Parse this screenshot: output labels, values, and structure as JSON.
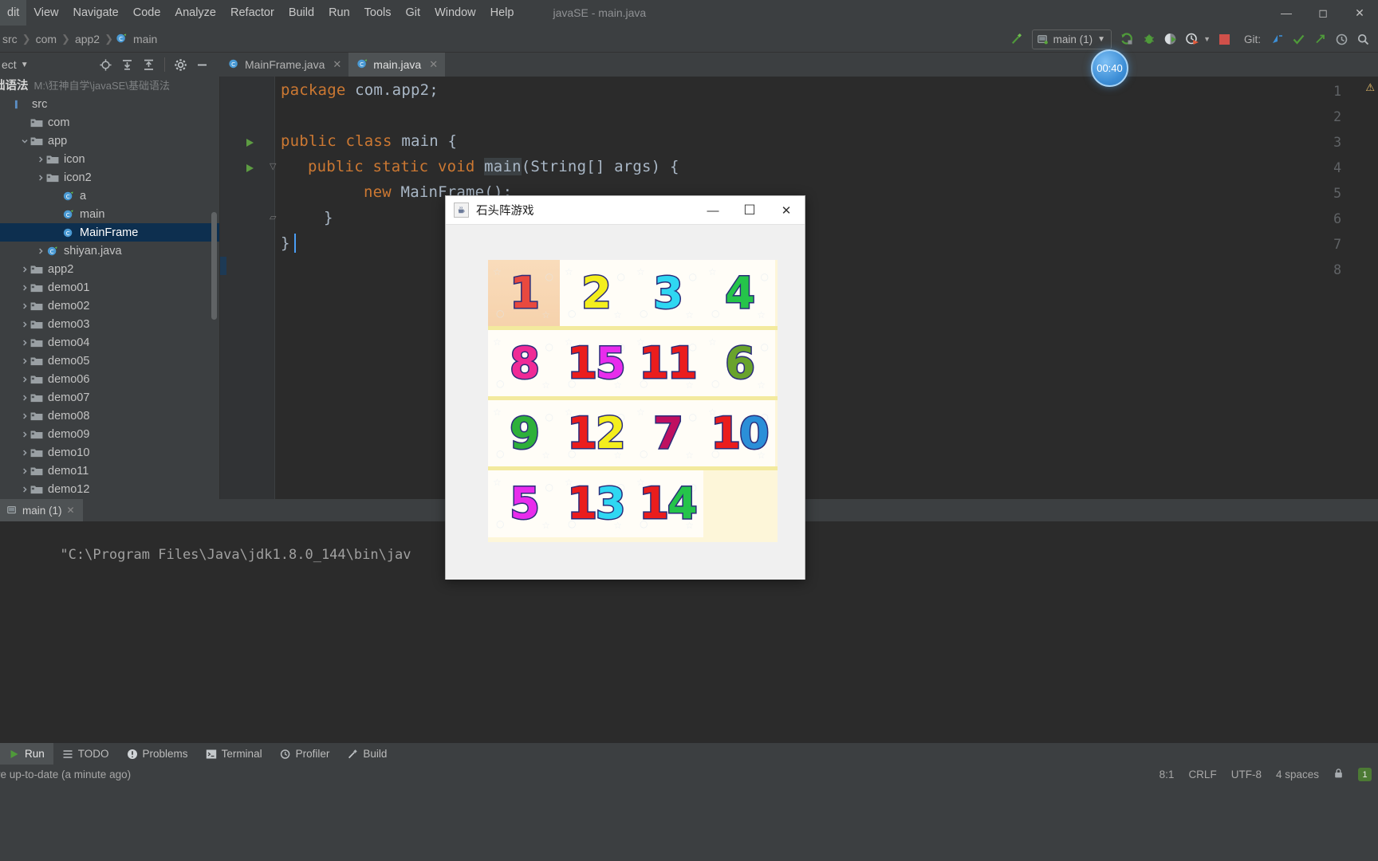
{
  "window": {
    "title": "javaSE - main.java",
    "minimize": "—",
    "maximize": "☐",
    "close": "✕"
  },
  "menubar": {
    "items": [
      {
        "label": "Edit",
        "visible": "dit"
      },
      {
        "label": "View"
      },
      {
        "label": "Navigate"
      },
      {
        "label": "Code"
      },
      {
        "label": "Analyze"
      },
      {
        "label": "Refactor"
      },
      {
        "label": "Build"
      },
      {
        "label": "Run"
      },
      {
        "label": "Tools"
      },
      {
        "label": "Git"
      },
      {
        "label": "Window"
      },
      {
        "label": "Help"
      }
    ]
  },
  "breadcrumb": {
    "items": [
      "src",
      "com",
      "app2",
      "main"
    ],
    "separator": "›",
    "last_icon": "java-class-icon"
  },
  "toolbar": {
    "build_icon": "hammer-icon",
    "run_config": "main (1)",
    "run_config_dropdown": "▾",
    "run_icon": "run-icon",
    "debug_icon": "debug-bug-icon",
    "run_coverage_icon": "run-with-coverage-icon",
    "profile_icon": "profiler-clock-icon",
    "profile_dropdown": "▾",
    "stop_icon": "stop-square-icon",
    "git_label": "Git:",
    "git_update_icon": "git-update-icon",
    "git_commit_icon": "git-commit-check-icon",
    "git_push_icon": "git-push-icon",
    "git_history_icon": "git-history-icon",
    "search_icon": "search-icon"
  },
  "toolstrip": {
    "project_label": "ect",
    "project_dropdown": "▾",
    "locate_icon": "locate-target-icon",
    "expand_icon": "expand-all-icon",
    "collapse_icon": "collapse-all-icon",
    "settings_icon": "gear-icon",
    "hide_icon": "hide-minus-icon"
  },
  "tabs": [
    {
      "label": "MainFrame.java",
      "icon": "java-class-icon",
      "active": false,
      "close": "✕"
    },
    {
      "label": "main.java",
      "icon": "java-class-icon",
      "active": true,
      "close": "✕"
    }
  ],
  "project_tree": {
    "root_name": "础语法",
    "root_path": "M:\\狂神自学\\javaSE\\基础语法",
    "nodes": [
      {
        "label": "src",
        "depth": 0,
        "icon": "source-root-icon",
        "arrow": "",
        "selected": false
      },
      {
        "label": "com",
        "depth": 1,
        "icon": "folder-icon",
        "arrow": "",
        "selected": false
      },
      {
        "label": "app",
        "depth": 1,
        "icon": "folder-icon",
        "arrow": "⌄",
        "selected": false
      },
      {
        "label": "icon",
        "depth": 2,
        "icon": "folder-icon",
        "arrow": "›",
        "selected": false
      },
      {
        "label": "icon2",
        "depth": 2,
        "icon": "folder-icon",
        "arrow": "›",
        "selected": false
      },
      {
        "label": "a",
        "depth": 3,
        "icon": "java-class-icon",
        "arrow": "",
        "selected": false
      },
      {
        "label": "main",
        "depth": 3,
        "icon": "java-class-icon",
        "arrow": "",
        "selected": false
      },
      {
        "label": "MainFrame",
        "depth": 3,
        "icon": "java-class-icon",
        "arrow": "",
        "selected": true
      },
      {
        "label": "shiyan.java",
        "depth": 2,
        "icon": "java-class-icon",
        "arrow": "›",
        "selected": false
      },
      {
        "label": "app2",
        "depth": 1,
        "icon": "folder-icon",
        "arrow": "›",
        "selected": false
      },
      {
        "label": "demo01",
        "depth": 1,
        "icon": "folder-icon",
        "arrow": "›",
        "selected": false
      },
      {
        "label": "demo02",
        "depth": 1,
        "icon": "folder-icon",
        "arrow": "›",
        "selected": false
      },
      {
        "label": "demo03",
        "depth": 1,
        "icon": "folder-icon",
        "arrow": "›",
        "selected": false
      },
      {
        "label": "demo04",
        "depth": 1,
        "icon": "folder-icon",
        "arrow": "›",
        "selected": false
      },
      {
        "label": "demo05",
        "depth": 1,
        "icon": "folder-icon",
        "arrow": "›",
        "selected": false
      },
      {
        "label": "demo06",
        "depth": 1,
        "icon": "folder-icon",
        "arrow": "›",
        "selected": false
      },
      {
        "label": "demo07",
        "depth": 1,
        "icon": "folder-icon",
        "arrow": "›",
        "selected": false
      },
      {
        "label": "demo08",
        "depth": 1,
        "icon": "folder-icon",
        "arrow": "›",
        "selected": false
      },
      {
        "label": "demo09",
        "depth": 1,
        "icon": "folder-icon",
        "arrow": "›",
        "selected": false
      },
      {
        "label": "demo10",
        "depth": 1,
        "icon": "folder-icon",
        "arrow": "›",
        "selected": false
      },
      {
        "label": "demo11",
        "depth": 1,
        "icon": "folder-icon",
        "arrow": "›",
        "selected": false
      },
      {
        "label": "demo12",
        "depth": 1,
        "icon": "folder-icon",
        "arrow": "›",
        "selected": false
      }
    ]
  },
  "editor": {
    "line_numbers": [
      "1",
      "2",
      "3",
      "4",
      "5",
      "6",
      "7",
      "8"
    ],
    "lines": [
      {
        "n": 1,
        "text": "package com.app2;"
      },
      {
        "n": 2,
        "text": ""
      },
      {
        "n": 3,
        "text": "public class main {"
      },
      {
        "n": 4,
        "text": "public static void main(String[] args) {"
      },
      {
        "n": 5,
        "text": "new MainFrame();"
      },
      {
        "n": 6,
        "text": "}"
      },
      {
        "n": 7,
        "text": "}"
      },
      {
        "n": 8,
        "text": ""
      }
    ],
    "tokens": {
      "l1_kw": "package",
      "l1_rest": " com.app2;",
      "l3_kw1": "public",
      "l3_kw2": "class",
      "l3_name": "main {",
      "l4_kw1": "public",
      "l4_kw2": "static",
      "l4_kw3": "void",
      "l4_name": "main",
      "l4_rest": "(String[] args) {",
      "l5_kw": "new",
      "l5_rest": " MainFrame();",
      "l6": "}",
      "l7": "}"
    },
    "warning_icon": "warning-triangle-icon"
  },
  "timer": {
    "value": "00:40"
  },
  "run_panel": {
    "tab_label": "main (1)",
    "tab_icon": "run-config-icon",
    "tab_close": "✕",
    "console_text": "\"C:\\Program Files\\Java\\jdk1.8.0_144\\bin\\jav"
  },
  "bottom_bar": {
    "buttons": [
      {
        "label": "Run",
        "icon": "run-icon",
        "active": true
      },
      {
        "label": "TODO",
        "icon": "todo-list-icon",
        "active": false
      },
      {
        "label": "Problems",
        "icon": "problems-icon",
        "active": false
      },
      {
        "label": "Terminal",
        "icon": "terminal-icon",
        "active": false
      },
      {
        "label": "Profiler",
        "icon": "profiler-icon",
        "active": false
      },
      {
        "label": "Build",
        "icon": "build-hammer-icon",
        "active": false
      }
    ]
  },
  "status_bar": {
    "message": "re up-to-date (a minute ago)",
    "caret": "8:1",
    "line_sep": "CRLF",
    "encoding": "UTF-8",
    "indent": "4 spaces",
    "notification_count": "1",
    "lock_icon": "lock-icon"
  },
  "game_window": {
    "title": "石头阵游戏",
    "icon": "java-coffee-cup-icon",
    "minimize": "—",
    "maximize": "☐",
    "close": "✕",
    "board": {
      "rows": 4,
      "cols": 4,
      "cells": [
        [
          {
            "value": "1",
            "digits": [
              {
                "t": "1",
                "c": "#e8493f"
              }
            ],
            "highlighted": true
          },
          {
            "value": "2",
            "digits": [
              {
                "t": "2",
                "c": "#f4ee1d"
              }
            ],
            "highlighted": false
          },
          {
            "value": "3",
            "digits": [
              {
                "t": "3",
                "c": "#2fd7f2"
              }
            ],
            "highlighted": false
          },
          {
            "value": "4",
            "digits": [
              {
                "t": "4",
                "c": "#25c44a"
              }
            ],
            "highlighted": false
          }
        ],
        [
          {
            "value": "8",
            "digits": [
              {
                "t": "8",
                "c": "#ef2a96"
              }
            ],
            "highlighted": false
          },
          {
            "value": "15",
            "digits": [
              {
                "t": "1",
                "c": "#ea1d1d"
              },
              {
                "t": "5",
                "c": "#e82cec"
              }
            ],
            "highlighted": false
          },
          {
            "value": "11",
            "digits": [
              {
                "t": "1",
                "c": "#ea1d1d"
              },
              {
                "t": "1",
                "c": "#ea1d1d"
              }
            ],
            "highlighted": false
          },
          {
            "value": "6",
            "digits": [
              {
                "t": "6",
                "c": "#69a32c"
              }
            ],
            "highlighted": false
          }
        ],
        [
          {
            "value": "9",
            "digits": [
              {
                "t": "9",
                "c": "#2eb03a"
              }
            ],
            "highlighted": false
          },
          {
            "value": "12",
            "digits": [
              {
                "t": "1",
                "c": "#ea1d1d"
              },
              {
                "t": "2",
                "c": "#f4ee1d"
              }
            ],
            "highlighted": false
          },
          {
            "value": "7",
            "digits": [
              {
                "t": "7",
                "c": "#bf1060"
              }
            ],
            "highlighted": false
          },
          {
            "value": "10",
            "digits": [
              {
                "t": "1",
                "c": "#ea1d1d"
              },
              {
                "t": "0",
                "c": "#2b8fd8"
              }
            ],
            "highlighted": false
          }
        ],
        [
          {
            "value": "5",
            "digits": [
              {
                "t": "5",
                "c": "#e82cec"
              }
            ],
            "highlighted": false
          },
          {
            "value": "13",
            "digits": [
              {
                "t": "1",
                "c": "#ea1d1d"
              },
              {
                "t": "3",
                "c": "#2fd7f2"
              }
            ],
            "highlighted": false
          },
          {
            "value": "14",
            "digits": [
              {
                "t": "1",
                "c": "#ea1d1d"
              },
              {
                "t": "4",
                "c": "#25c44a"
              }
            ],
            "highlighted": false
          },
          {
            "value": "",
            "digits": [],
            "highlighted": false,
            "blank": true
          }
        ]
      ]
    }
  },
  "colors": {
    "ide_bg": "#3c3f41",
    "editor_bg": "#2b2b2b",
    "selection": "#0d2f4f",
    "accent_green": "#5d9c42",
    "accent_blue": "#4a9ef5",
    "keyword_orange": "#cc7832",
    "board_bg": "#fdf6d9",
    "tile_bg": "#fffdf7",
    "tile_highlight": "#f6d2ac"
  }
}
